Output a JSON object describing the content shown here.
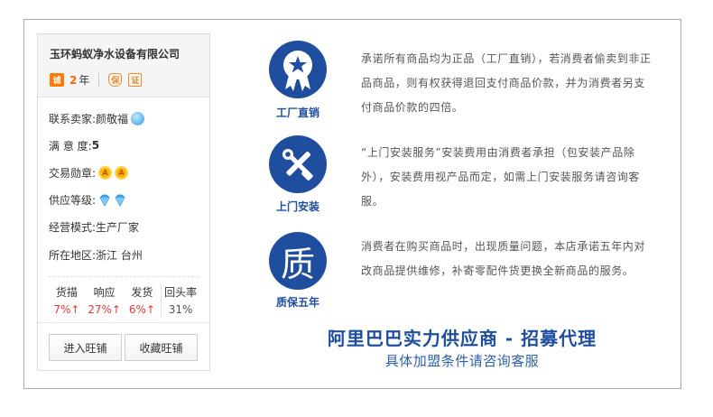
{
  "seller": {
    "company": "玉环蚂蚁净水设备有限公司",
    "year_badge": "诚",
    "years": "2",
    "years_unit": "年",
    "badge_a": "保",
    "badge_b": "证",
    "contact_label": "联系卖家:",
    "contact_name": "颜敬福",
    "satisfaction_label": "满 意 度:",
    "satisfaction_value": "5",
    "medal_label": "交易勋章:",
    "medal_glyph": "A",
    "level_label": "供应等级:",
    "mode_label": "经营模式:",
    "mode_value": "生产厂家",
    "region_label": "所在地区:",
    "region_value": "浙江 台州"
  },
  "stats": [
    {
      "label": "货描",
      "value": "7%↑"
    },
    {
      "label": "响应",
      "value": "27%↑"
    },
    {
      "label": "发货",
      "value": "6%↑"
    },
    {
      "label": "回头率",
      "value": "31%"
    }
  ],
  "buttons": {
    "enter_shop": "进入旺铺",
    "favorite_shop": "收藏旺铺"
  },
  "promises": [
    {
      "icon": "star-ribbon-icon",
      "label": "工厂直销",
      "text": "承诺所有商品均为正品（工厂直销），若消费者偷卖到非正品商品，则有权获得退回支付商品价款，并为消费者另支付商品价款的四倍。"
    },
    {
      "icon": "wrench-screwdriver-icon",
      "label": "上门安装",
      "text": "“上门安装服务”安装费用由消费者承担（包安装产品除外），安装费用视产品而定，如需上门安装服务请咨询客服。"
    },
    {
      "icon": "quality-icon",
      "glyph": "质",
      "label": "质保五年",
      "text": "消费者在购买商品时，出现质量问题，本店承诺五年内对改商品提供维修，补寄零配件货更换全新商品的服务。"
    }
  ],
  "slogan": "阿里巴巴实力供应商 - 招募代理",
  "subslogan": "具体加盟条件请咨询客服",
  "colors": {
    "brand_blue": "#1f4e9e",
    "accent_orange": "#ff6600",
    "stat_red": "#e4393c"
  }
}
